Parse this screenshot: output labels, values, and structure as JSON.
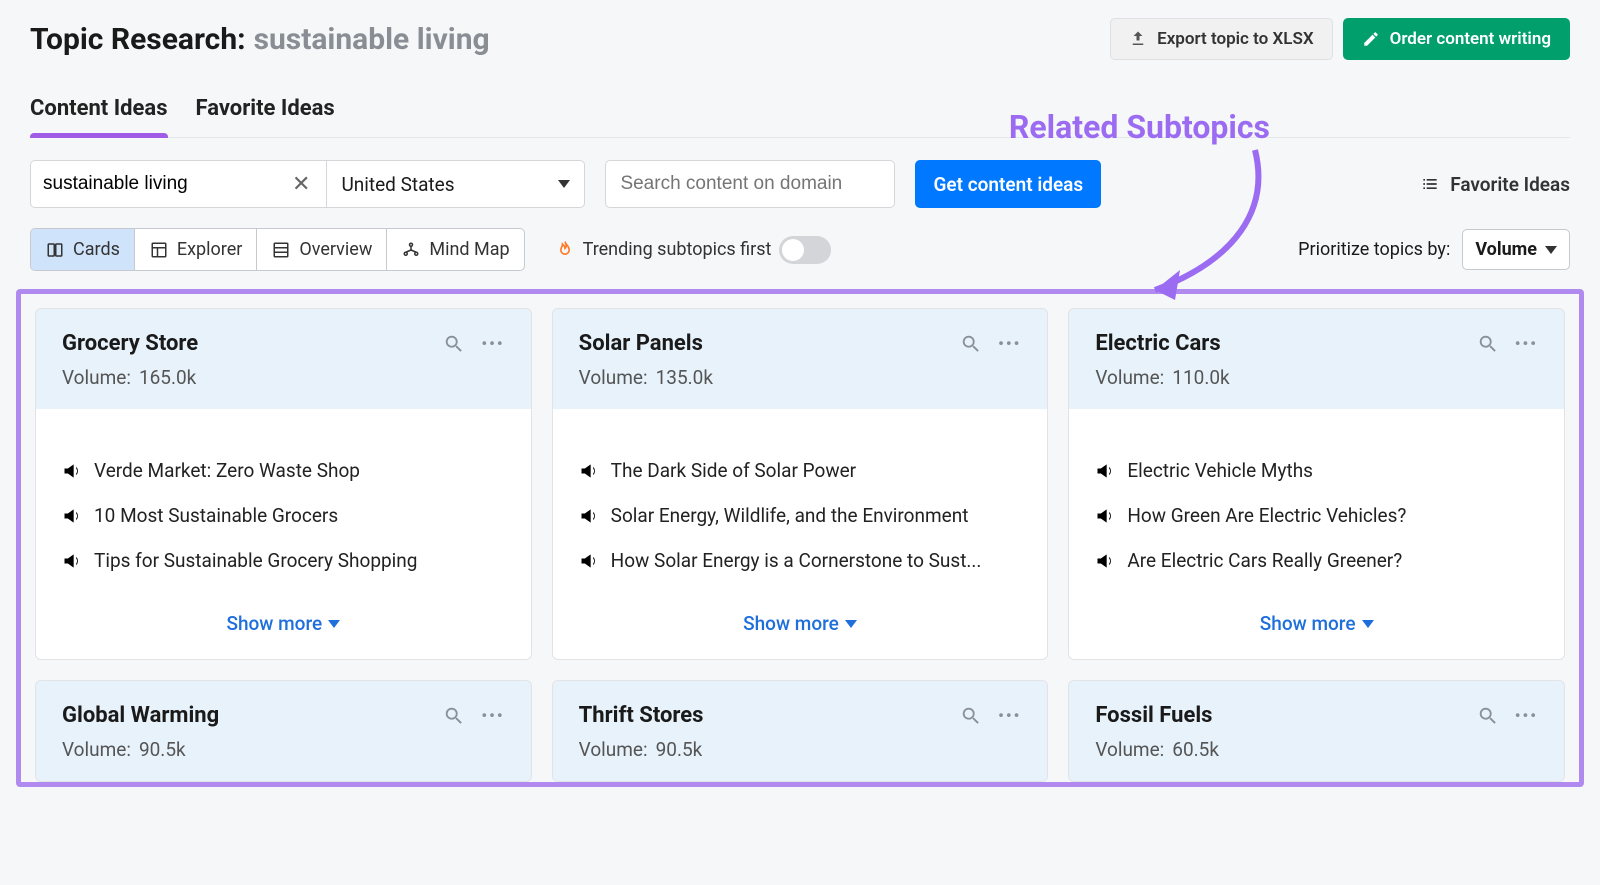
{
  "header": {
    "title_prefix": "Topic Research:",
    "title_query": "sustainable living",
    "export_label": "Export topic to XLSX",
    "order_label": "Order content writing"
  },
  "tabs": {
    "content_ideas": "Content Ideas",
    "favorite_ideas": "Favorite Ideas"
  },
  "filters": {
    "topic_value": "sustainable living",
    "country_value": "United States",
    "search_placeholder": "Search content on domain",
    "get_ideas_label": "Get content ideas",
    "favorite_link": "Favorite Ideas"
  },
  "view": {
    "cards": "Cards",
    "explorer": "Explorer",
    "overview": "Overview",
    "mindmap": "Mind Map",
    "trending_label": "Trending subtopics first",
    "prioritize_label": "Prioritize topics by:",
    "prioritize_value": "Volume"
  },
  "annotation": "Related Subtopics",
  "common": {
    "volume_label": "Volume:",
    "show_more": "Show more"
  },
  "cards": [
    {
      "title": "Grocery Store",
      "volume": "165.0k",
      "ideas": [
        {
          "color": "green",
          "text": "Verde Market: Zero Waste Shop"
        },
        {
          "color": "blue",
          "text": "10 Most Sustainable Grocers"
        },
        {
          "color": "blue",
          "text": "Tips for Sustainable Grocery Shopping"
        }
      ]
    },
    {
      "title": "Solar Panels",
      "volume": "135.0k",
      "ideas": [
        {
          "color": "green",
          "text": "The Dark Side of Solar Power"
        },
        {
          "color": "blue",
          "text": "Solar Energy, Wildlife, and the Environment"
        },
        {
          "color": "blue",
          "text": "How Solar Energy is a Cornerstone to Sust..."
        }
      ]
    },
    {
      "title": "Electric Cars",
      "volume": "110.0k",
      "ideas": [
        {
          "color": "green",
          "text": "Electric Vehicle Myths"
        },
        {
          "color": "blue",
          "text": "How Green Are Electric Vehicles?"
        },
        {
          "color": "blue",
          "text": "Are Electric Cars Really Greener?"
        }
      ]
    },
    {
      "title": "Global Warming",
      "volume": "90.5k",
      "ideas": []
    },
    {
      "title": "Thrift Stores",
      "volume": "90.5k",
      "ideas": []
    },
    {
      "title": "Fossil Fuels",
      "volume": "60.5k",
      "ideas": []
    }
  ]
}
